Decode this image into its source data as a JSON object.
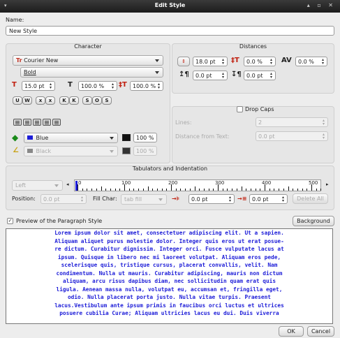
{
  "window": {
    "title": "Edit Style"
  },
  "name": {
    "label": "Name:",
    "value": "New Style"
  },
  "character": {
    "header": "Character",
    "font": "Courier New",
    "style": "Bold",
    "size": "15.0 pt",
    "scale_h": "100.0 %",
    "scale_v": "100.0 %",
    "effects": [
      "U",
      "W",
      "x",
      "x",
      "K",
      "K",
      "S",
      "O",
      "S"
    ],
    "fill_color": "Blue",
    "fill_shade": "100 %",
    "stroke_color": "Black",
    "stroke_shade": "100 %"
  },
  "distances": {
    "header": "Distances",
    "line_spacing": "18.0 pt",
    "space_above": "0.0 %",
    "tracking": "0.0 %",
    "space_before": "0.0 pt",
    "space_after": "0.0 pt"
  },
  "dropcaps": {
    "label": "Drop Caps",
    "checked": false,
    "lines_label": "Lines:",
    "lines_value": "2",
    "distance_label": "Distance from Text:",
    "distance_value": "0.0 pt"
  },
  "tabs": {
    "header": "Tabulators and Indentation",
    "alignment": "Left",
    "ruler_labels": [
      "0",
      "100",
      "200",
      "300",
      "400",
      "500"
    ],
    "position_label": "Position:",
    "position_value": "0.0 pt",
    "fillchar_label": "Fill Char:",
    "fillchar_value": "tab fill",
    "indent_first": "0.0 pt",
    "indent_left": "0.0 pt",
    "delete_all": "Delete All"
  },
  "preview": {
    "label": "Preview of the Paragraph Style",
    "checked": true,
    "background_button": "Background",
    "lines": [
      "Lorem ipsum dolor sit amet, consectetuer adipiscing elit. Ut a sapien.",
      "Aliquam aliquet purus molestie dolor. Integer quis eros ut erat posue-",
      "re dictum. Curabitur dignissim. Integer orci. Fusce vulputate lacus at",
      "ipsum. Quisque in libero nec mi laoreet volutpat. Aliquam eros pede,",
      "scelerisque quis, tristique cursus, placerat convallis, velit. Nam",
      "condimentum. Nulla ut mauris. Curabitur adipiscing, mauris non dictum",
      "aliquam, arcu risus dapibus diam, nec sollicitudin quam erat quis",
      "ligula. Aenean massa nulla, volutpat eu, accumsan et, fringilla eget,",
      "odio. Nulla placerat porta justo. Nulla vitae turpis. Praesent",
      "lacus.Vestibulum ante ipsum primis in faucibus orci luctus et ultrices",
      "posuere cubilia Curae; Aliquam ultricies lacus eu dui. Duis viverra"
    ]
  },
  "buttons": {
    "ok": "OK",
    "cancel": "Cancel"
  }
}
